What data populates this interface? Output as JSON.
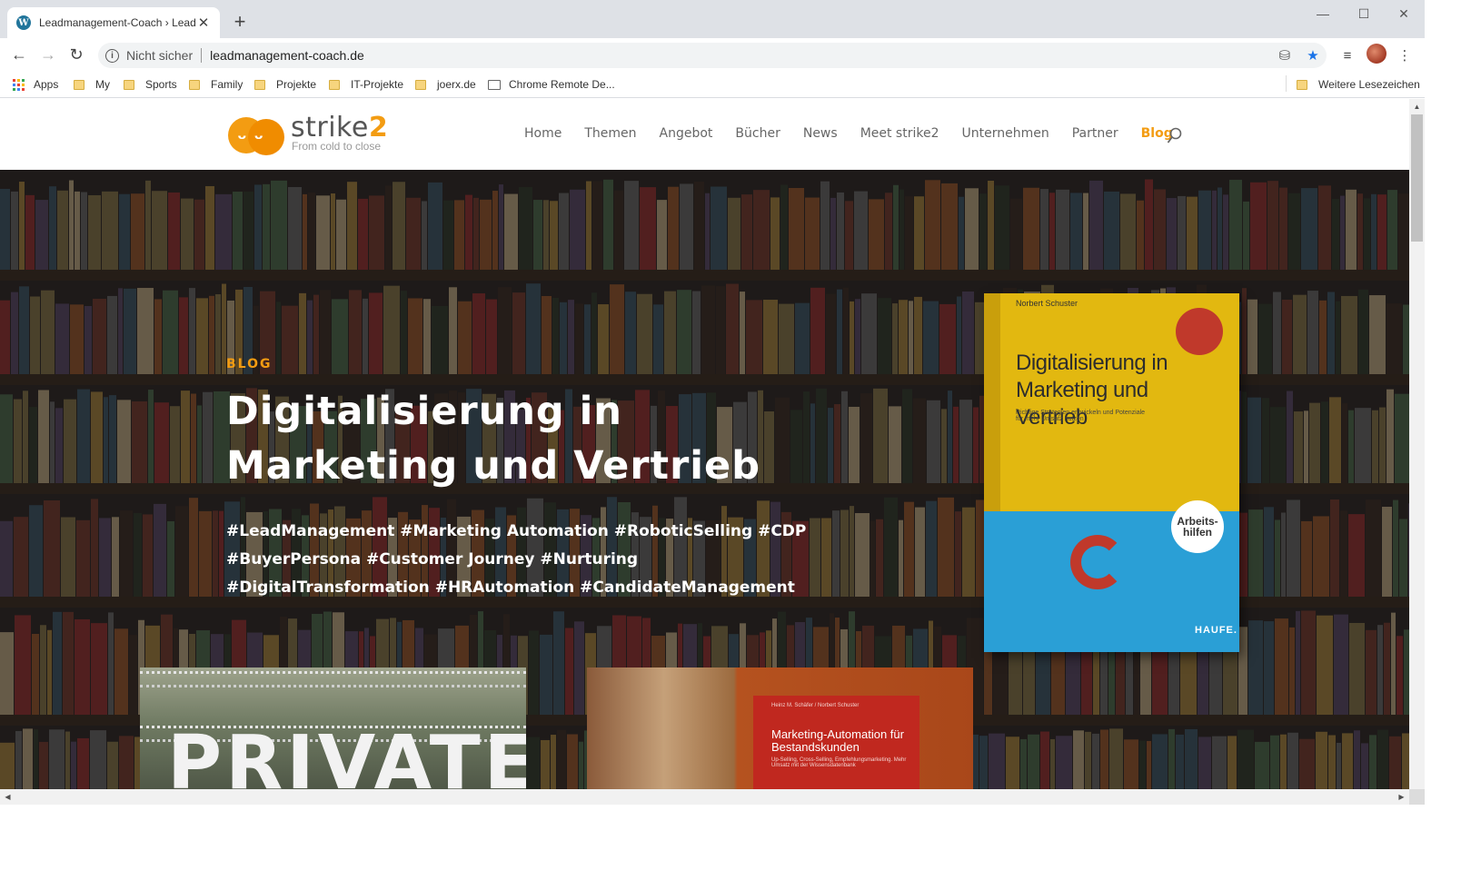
{
  "browser": {
    "tab_title": "Leadmanagement-Coach › Leadm",
    "tab_favicon": "wordpress-icon",
    "security_label": "Nicht sicher",
    "url": "leadmanagement-coach.de",
    "bookmarks": [
      {
        "label": "Apps",
        "icon": "apps-grid-icon"
      },
      {
        "label": "My",
        "icon": "folder-icon"
      },
      {
        "label": "Sports",
        "icon": "folder-icon"
      },
      {
        "label": "Family",
        "icon": "folder-icon"
      },
      {
        "label": "Projekte",
        "icon": "folder-icon"
      },
      {
        "label": "IT-Projekte",
        "icon": "folder-icon"
      },
      {
        "label": "joerx.de",
        "icon": "folder-icon"
      },
      {
        "label": "Chrome Remote De...",
        "icon": "remote-desktop-icon"
      }
    ],
    "other_bookmarks": "Weitere Lesezeichen"
  },
  "site": {
    "brand": "strike",
    "brand_suffix": "2",
    "tagline": "From cold to close",
    "nav": [
      {
        "label": "Home",
        "active": false
      },
      {
        "label": "Themen",
        "active": false
      },
      {
        "label": "Angebot",
        "active": false
      },
      {
        "label": "Bücher",
        "active": false
      },
      {
        "label": "News",
        "active": false
      },
      {
        "label": "Meet strike2",
        "active": false
      },
      {
        "label": "Unternehmen",
        "active": false
      },
      {
        "label": "Partner",
        "active": false
      },
      {
        "label": "Blog",
        "active": true
      }
    ],
    "accent_color": "#f39c12"
  },
  "hero": {
    "kicker": "BLOG",
    "title": "Digitalisierung in Marketing und Vertrieb",
    "tags": [
      "#LeadManagement #Marketing Automation #RoboticSelling #CDP",
      "#BuyerPersona #Customer Journey #Nurturing",
      "#DigitalTransformation #HRAutomation #CandidateManagement"
    ],
    "book": {
      "author": "Norbert Schuster",
      "title": "Digitalisierung in Marketing und Vertrieb",
      "subtitle": "Richtige Strategien entwickeln und Potenziale für mehr Umsatz nutzen",
      "sticker": "Arbeits-hilfen",
      "publisher": "HAUFE."
    }
  },
  "cards": [
    {
      "image_text": "PRIVATE"
    },
    {
      "book_author": "Heinz M. Schäfer / Norbert Schuster",
      "book_title": "Marketing-Automation für Bestandskunden",
      "book_subtitle": "Up-Selling, Cross-Selling, Empfehlungsmarketing. Mehr Umsatz mit der Wissensdatenbank"
    }
  ]
}
